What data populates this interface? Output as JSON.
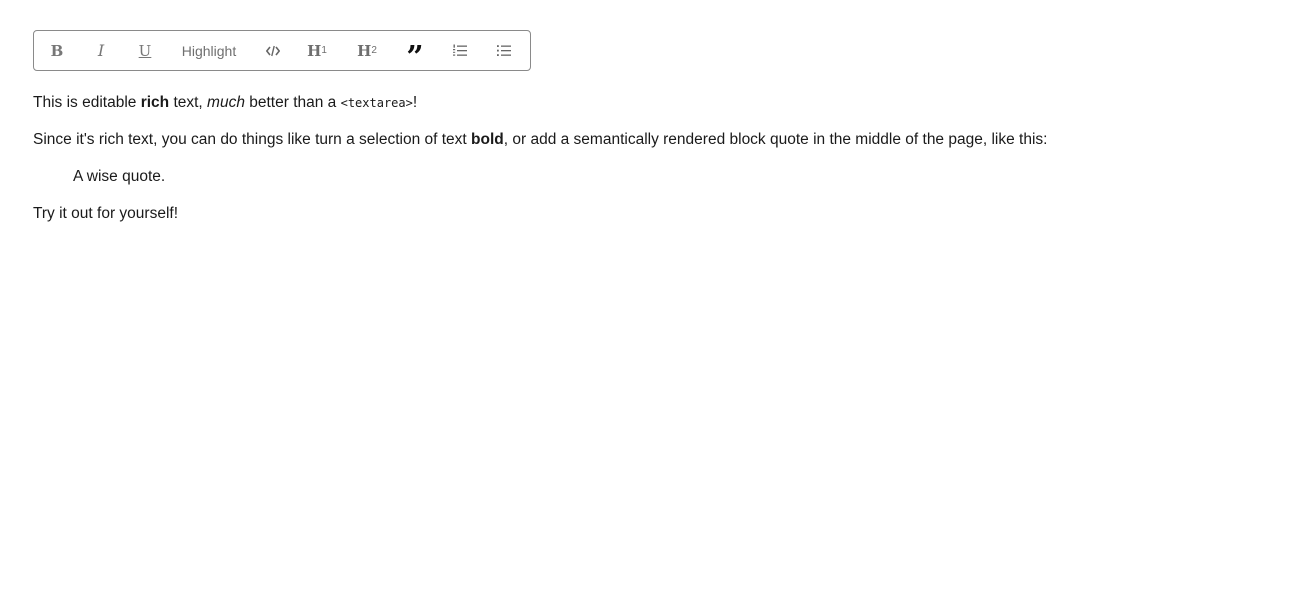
{
  "toolbar": {
    "bold_label": "B",
    "italic_label": "I",
    "underline_label": "U",
    "highlight_label": "Highlight",
    "code_icon": "code-icon",
    "h1_label": "H",
    "h1_sub": "1",
    "h2_label": "H",
    "h2_sub": "2",
    "quote_glyph": "”",
    "quote_icon": "blockquote-icon",
    "ordered_list_icon": "ordered-list-icon",
    "unordered_list_icon": "unordered-list-icon"
  },
  "document": {
    "p1": {
      "t1": "This is editable ",
      "t2_bold": "rich",
      "t3": " text, ",
      "t4_italic": "much",
      "t5": " better than a ",
      "t6_code": "<textarea>",
      "t7": "!"
    },
    "p2": {
      "t1": "Since it's rich text, you can do things like turn a selection of text ",
      "t2_bold": "bold",
      "t3": ", or add a semantically rendered block quote in the middle of the page, like this:"
    },
    "quote": "A wise quote.",
    "p3": "Try it out for yourself!"
  }
}
